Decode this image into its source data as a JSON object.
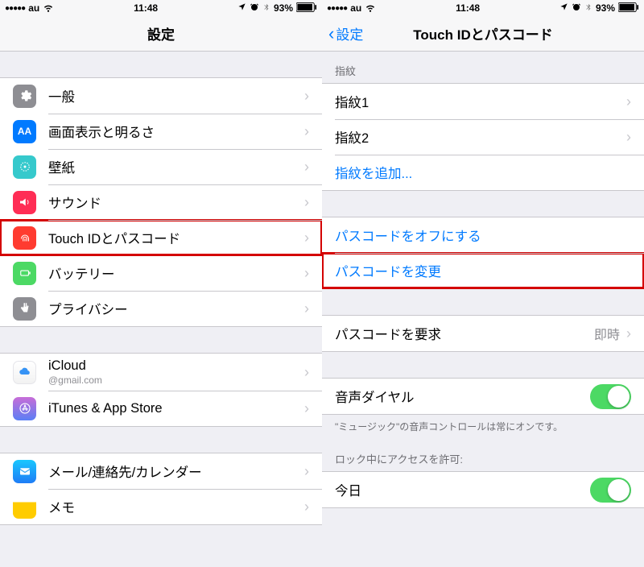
{
  "status": {
    "carrier": "au",
    "signal_dots": "●●●●●",
    "wifi": "wifi",
    "time": "11:48",
    "location": "location",
    "alarm": "alarm",
    "bluetooth": "bluetooth",
    "battery_pct": "93%"
  },
  "left": {
    "title": "設定",
    "groups": [
      {
        "items": [
          {
            "key": "general",
            "label": "一般"
          },
          {
            "key": "display",
            "label": "画面表示と明るさ"
          },
          {
            "key": "wallpaper",
            "label": "壁紙"
          },
          {
            "key": "sound",
            "label": "サウンド"
          },
          {
            "key": "touchid",
            "label": "Touch IDとパスコード",
            "highlight": true
          },
          {
            "key": "battery",
            "label": "バッテリー"
          },
          {
            "key": "privacy",
            "label": "プライバシー"
          }
        ]
      },
      {
        "items": [
          {
            "key": "icloud",
            "label": "iCloud",
            "sub": "@gmail.com"
          },
          {
            "key": "itunes",
            "label": "iTunes & App Store"
          }
        ]
      },
      {
        "items": [
          {
            "key": "mail",
            "label": "メール/連絡先/カレンダー"
          },
          {
            "key": "notes",
            "label": "メモ"
          }
        ]
      }
    ]
  },
  "right": {
    "back_label": "設定",
    "title": "Touch IDとパスコード",
    "fingerprint_header": "指紋",
    "fingerprint1": "指紋1",
    "fingerprint2": "指紋2",
    "add_fingerprint": "指紋を追加...",
    "passcode_off": "パスコードをオフにする",
    "change_passcode": "パスコードを変更",
    "require_passcode": "パスコードを要求",
    "require_passcode_value": "即時",
    "voice_dial": "音声ダイヤル",
    "voice_dial_footer": "\"ミュージック\"の音声コントロールは常にオンです。",
    "lock_access_header": "ロック中にアクセスを許可:",
    "today": "今日"
  }
}
